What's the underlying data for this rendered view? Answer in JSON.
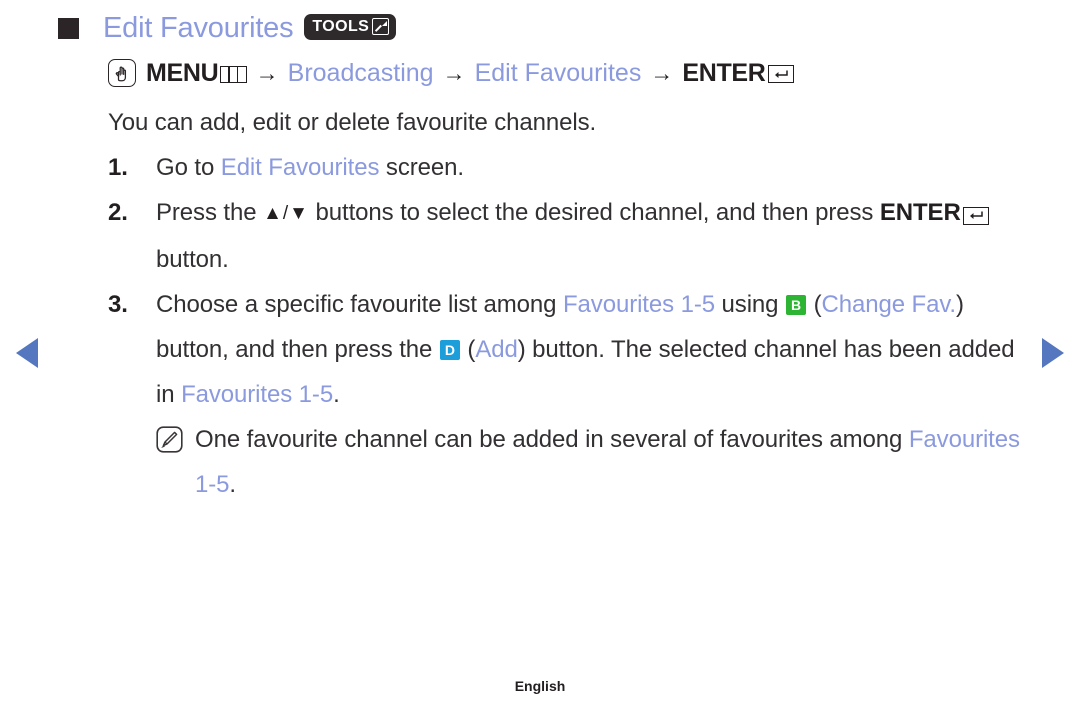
{
  "page": {
    "title": "Edit Favourites",
    "tools_badge_label": "TOOLS",
    "footer_label": "English"
  },
  "menu_path": {
    "menu_label": "MENU",
    "arrow": "→",
    "item_broadcasting": "Broadcasting",
    "item_edit_favourites": "Edit Favourites",
    "enter_label": "ENTER"
  },
  "intro": "You can add, edit or delete favourite channels.",
  "steps": [
    {
      "number": "1.",
      "text_1": "Go to ",
      "highlight_1": "Edit Favourites",
      "text_2": " screen."
    },
    {
      "number": "2.",
      "text_1": "Press the ",
      "arrows": "▲/▼",
      "text_2": " buttons to select the desired channel, and then press ",
      "enter_label": "ENTER",
      "text_3": " button."
    },
    {
      "number": "3.",
      "text_1": "Choose a specific favourite list among ",
      "highlight_1": "Favourites 1-5",
      "text_2": " using ",
      "key_b": "B",
      "text_3": " (",
      "highlight_2": "Change Fav.",
      "text_4": ") button, and then press the ",
      "key_d": "D",
      "text_5": " (",
      "highlight_3": "Add",
      "text_6": ") button. The selected channel has been added in ",
      "highlight_4": "Favourites 1-5",
      "text_7": "."
    }
  ],
  "note": {
    "text_1": "One favourite channel can be added in several of favourites among ",
    "highlight_1": "Favourites 1-5",
    "text_2": "."
  },
  "colors": {
    "accent_blue": "#8b9ade",
    "text": "#333033",
    "key_b_green": "#2cb432",
    "key_d_blue": "#1b9ed9",
    "nav_arrow": "#5577bf",
    "tools_badge_bg": "#2e2a2b"
  }
}
